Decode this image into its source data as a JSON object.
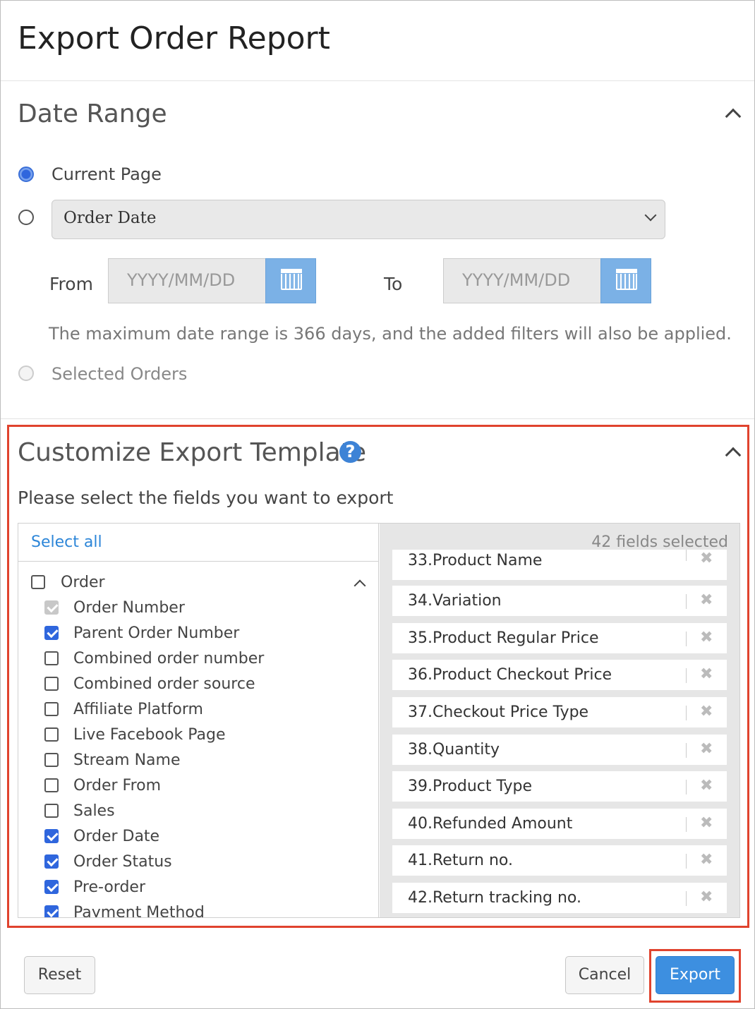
{
  "dialog": {
    "title": "Export Order Report"
  },
  "date_range": {
    "title": "Date Range",
    "options": [
      {
        "label": "Current Page",
        "selected": true
      },
      {
        "label": "",
        "selected": false
      },
      {
        "label": "Selected Orders",
        "selected": false,
        "disabled": true
      }
    ],
    "date_type": {
      "selected": "Order Date"
    },
    "from": {
      "label": "From",
      "placeholder": "YYYY/MM/DD"
    },
    "to": {
      "label": "To",
      "placeholder": "YYYY/MM/DD"
    },
    "hint": "The maximum date range is 366 days, and the added filters will also be applied."
  },
  "template": {
    "title": "Customize Export Template",
    "help_icon": "question-circle-icon",
    "instruction": "Please select the fields you want to export",
    "select_all": "Select all",
    "selected_count": "42 fields selected",
    "group": {
      "label": "Order",
      "checked": false
    },
    "fields": [
      {
        "label": "Order Number",
        "state": "locked"
      },
      {
        "label": "Parent Order Number",
        "state": "checked"
      },
      {
        "label": "Combined order number",
        "state": "unchecked"
      },
      {
        "label": "Combined order source",
        "state": "unchecked"
      },
      {
        "label": "Affiliate Platform",
        "state": "unchecked"
      },
      {
        "label": "Live Facebook Page",
        "state": "unchecked"
      },
      {
        "label": "Stream Name",
        "state": "unchecked"
      },
      {
        "label": "Order From",
        "state": "unchecked"
      },
      {
        "label": "Sales",
        "state": "unchecked"
      },
      {
        "label": "Order Date",
        "state": "checked"
      },
      {
        "label": "Order Status",
        "state": "checked"
      },
      {
        "label": "Pre-order",
        "state": "checked"
      },
      {
        "label": "Payment Method",
        "state": "checked"
      }
    ],
    "selected_fields": [
      "33.Product Name",
      "34.Variation",
      "35.Product Regular Price",
      "36.Product Checkout Price",
      "37.Checkout Price Type",
      "38.Quantity",
      "39.Product Type",
      "40.Refunded Amount",
      "41.Return no.",
      "42.Return tracking no."
    ],
    "remove_glyph": "✖"
  },
  "footer": {
    "reset": "Reset",
    "cancel": "Cancel",
    "export": "Export"
  },
  "colors": {
    "highlight": "#e0432e",
    "primary": "#3d8fe0",
    "link": "#2d86d8"
  }
}
